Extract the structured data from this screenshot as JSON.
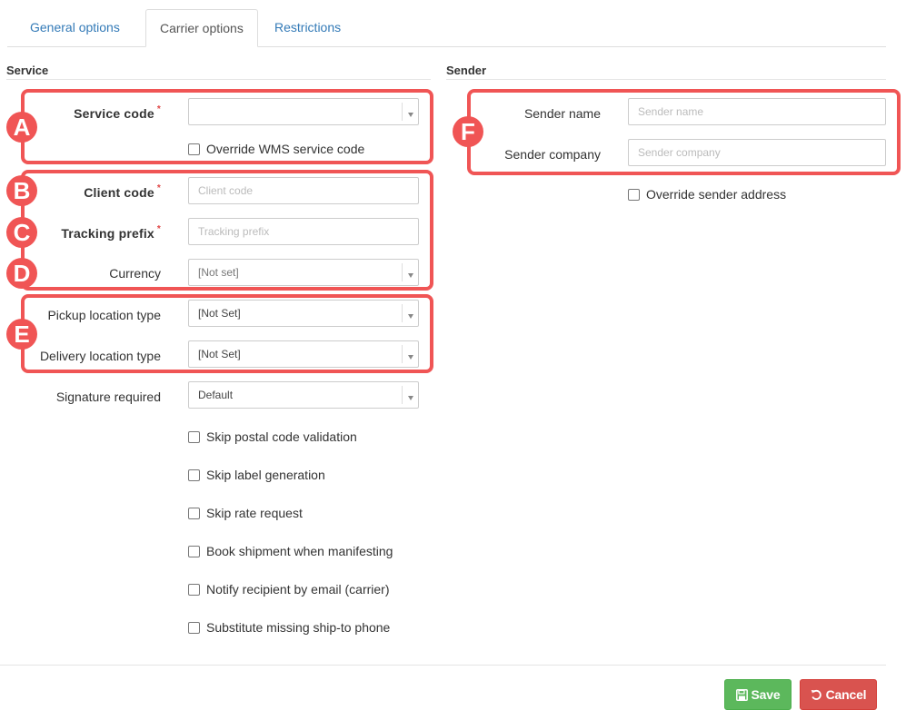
{
  "tabs": [
    {
      "label": "General options",
      "active": false
    },
    {
      "label": "Carrier options",
      "active": true
    },
    {
      "label": "Restrictions",
      "active": false
    }
  ],
  "service": {
    "title": "Service",
    "service_code": {
      "label": "Service code",
      "value": ""
    },
    "override_wms": {
      "label": "Override WMS service code",
      "checked": false
    },
    "client_code": {
      "label": "Client code",
      "placeholder": "Client code"
    },
    "tracking_prefix": {
      "label": "Tracking prefix",
      "placeholder": "Tracking prefix"
    },
    "currency": {
      "label": "Currency",
      "value": "[Not set]"
    },
    "pickup_location_type": {
      "label": "Pickup location type",
      "value": "[Not Set]"
    },
    "delivery_location_type": {
      "label": "Delivery location type",
      "value": "[Not Set]"
    },
    "signature_required": {
      "label": "Signature required",
      "value": "Default"
    },
    "required_marker": "*",
    "checkboxes": [
      {
        "label": "Skip postal code validation",
        "checked": false
      },
      {
        "label": "Skip label generation",
        "checked": false
      },
      {
        "label": "Skip rate request",
        "checked": false
      },
      {
        "label": "Book shipment when manifesting",
        "checked": false
      },
      {
        "label": "Notify recipient by email (carrier)",
        "checked": false
      },
      {
        "label": "Substitute missing ship-to phone",
        "checked": false
      }
    ]
  },
  "sender": {
    "title": "Sender",
    "sender_name": {
      "label": "Sender name",
      "placeholder": "Sender name"
    },
    "sender_company": {
      "label": "Sender company",
      "placeholder": "Sender company"
    },
    "override_address": {
      "label": "Override sender address",
      "checked": false
    }
  },
  "annotations": {
    "color": "#f05555",
    "badges": [
      "A",
      "B",
      "C",
      "D",
      "E",
      "F"
    ]
  },
  "footer": {
    "save_label": "Save",
    "cancel_label": "Cancel",
    "save_icon": "floppy-disk-icon",
    "cancel_icon": "undo-icon"
  },
  "colors": {
    "link": "#337ab7",
    "save": "#5cb85c",
    "cancel": "#d9534f",
    "required": "#e04646"
  }
}
